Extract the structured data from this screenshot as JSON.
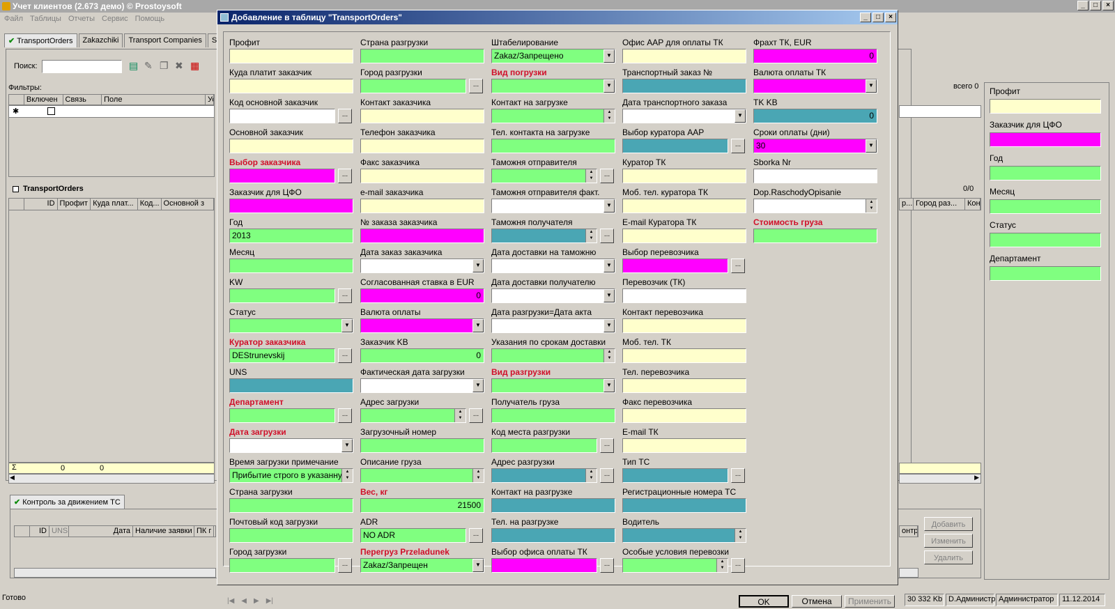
{
  "main": {
    "title": "Учет клиентов (2.673 демо) © Prostoysoft",
    "menu": [
      "Файл",
      "Таблицы",
      "Отчеты",
      "Сервис",
      "Помощь"
    ],
    "tabs": [
      "TransportOrders",
      "Zakazchiki",
      "Transport Companies",
      "S"
    ],
    "search_label": "Поиск:",
    "filters_label": "Фильтры:",
    "filter_cols": [
      "Включен",
      "Связь",
      "Поле",
      "Ус"
    ],
    "grid_title": "TransportOrders",
    "grid_count": "0/0",
    "grid_cols": [
      "ID",
      "Профит",
      "Куда плат...",
      "Код...",
      "Основной з"
    ],
    "grid_cols_right": [
      "р...",
      "Город раз...",
      "Кон"
    ],
    "sum_values": [
      "0",
      "0"
    ],
    "total_label": "всего 0",
    "bottom_tab": "Контроль за движением ТС",
    "bottom_cols": [
      "ID",
      "UNS",
      "Дата",
      "Наличие заявки",
      "ПК г"
    ],
    "bottom_right_col": "онтр",
    "side_buttons": [
      "Добавить",
      "Изменить",
      "Удалить"
    ],
    "right_panel": [
      "Профит",
      "Заказчик для ЦФО",
      "Год",
      "Месяц",
      "Статус",
      "Департамент"
    ],
    "status": {
      "ready": "Готово",
      "mem": "30 332 Kb",
      "user1": "D.Администр",
      "user2": "Администратор",
      "date": "11.12.2014"
    }
  },
  "dialog": {
    "title": "Добавление в таблицу \"TransportOrders\"",
    "ok": "OK",
    "cancel": "Отмена",
    "apply": "Применить",
    "col1": [
      {
        "label": "Профит",
        "value": "",
        "color": "y"
      },
      {
        "label": "Куда платит заказчик",
        "value": "",
        "color": "y"
      },
      {
        "label": "Код основной заказчик",
        "value": "",
        "color": "w",
        "ell": true
      },
      {
        "label": "Основной заказчик",
        "value": "",
        "color": "y"
      },
      {
        "label": "Выбор заказчика",
        "value": "",
        "color": "m",
        "ell": true,
        "red": true
      },
      {
        "label": "Заказчик для ЦФО",
        "value": "",
        "color": "m"
      },
      {
        "label": "Год",
        "value": "2013",
        "color": "g"
      },
      {
        "label": "Месяц",
        "value": "",
        "color": "g"
      },
      {
        "label": "KW",
        "value": "",
        "color": "g",
        "ell": true
      },
      {
        "label": "Статус",
        "value": "",
        "color": "g",
        "dd": true
      },
      {
        "label": "Куратор заказчика",
        "value": "DEStrunevskij",
        "color": "g",
        "ell": true,
        "red": true
      },
      {
        "label": "UNS",
        "value": "",
        "color": "t"
      },
      {
        "label": "Департамент",
        "value": "",
        "color": "g",
        "ell": true,
        "red": true
      },
      {
        "label": "Дата загрузки",
        "value": "",
        "color": "w",
        "dd": true,
        "red": true
      },
      {
        "label": "Время загрузки примечание",
        "value": "Прибытие строго в указанную",
        "color": "g",
        "spin": true
      },
      {
        "label": "Страна загрузки",
        "value": "",
        "color": "g"
      },
      {
        "label": "Почтовый код загрузки",
        "value": "",
        "color": "g"
      },
      {
        "label": "Город загрузки",
        "value": "",
        "color": "g",
        "ell": true
      }
    ],
    "col2": [
      {
        "label": "Страна разгрузки",
        "value": "",
        "color": "g"
      },
      {
        "label": "Город разгрузки",
        "value": "",
        "color": "g",
        "ell": true
      },
      {
        "label": "Контакт заказчика",
        "value": "",
        "color": "y"
      },
      {
        "label": "Телефон заказчика",
        "value": "",
        "color": "y"
      },
      {
        "label": "Факс заказчика",
        "value": "",
        "color": "y"
      },
      {
        "label": "e-mail заказчика",
        "value": "",
        "color": "y"
      },
      {
        "label": "№ заказа заказчика",
        "value": "",
        "color": "m"
      },
      {
        "label": "Дата заказ заказчика",
        "value": "",
        "color": "w",
        "dd": true
      },
      {
        "label": "Согласованная ставка в EUR",
        "value": "0",
        "color": "m",
        "num": true
      },
      {
        "label": "Валюта оплаты",
        "value": "",
        "color": "m",
        "dd": true
      },
      {
        "label": "Заказчик KB",
        "value": "0",
        "color": "g",
        "num": true
      },
      {
        "label": "Фактическая дата загрузки",
        "value": "",
        "color": "w",
        "dd": true
      },
      {
        "label": "Адрес загрузки",
        "value": "",
        "color": "g",
        "spin": true,
        "ell": true
      },
      {
        "label": "Загрузочный номер",
        "value": "",
        "color": "g"
      },
      {
        "label": "Описание груза",
        "value": "",
        "color": "g",
        "spin": true
      },
      {
        "label": "Вес, кг",
        "value": "21500",
        "color": "g",
        "num": true,
        "red": true
      },
      {
        "label": "ADR",
        "value": "NO ADR",
        "color": "g",
        "ell": true
      },
      {
        "label": "Перегруз Przeladunek",
        "value": "Zakaz/Запрещен",
        "color": "g",
        "dd": true,
        "red": true
      }
    ],
    "col3": [
      {
        "label": "Штабелирование",
        "value": "Zakaz/Запрещено",
        "color": "g",
        "dd": true
      },
      {
        "label": "Вид погрузки",
        "value": "",
        "color": "g",
        "dd": true,
        "red": true
      },
      {
        "label": "Контакт на загрузке",
        "value": "",
        "color": "g",
        "spin": true
      },
      {
        "label": "Тел. контакта на загрузке",
        "value": "",
        "color": "g"
      },
      {
        "label": "Таможня отправителя",
        "value": "",
        "color": "g",
        "spin": true,
        "ell": true
      },
      {
        "label": "Таможня отправителя факт.",
        "value": "",
        "color": "w",
        "dd": true
      },
      {
        "label": "Таможня получателя",
        "value": "",
        "color": "t",
        "spin": true,
        "ell": true
      },
      {
        "label": "Дата доставки на таможню",
        "value": "",
        "color": "w",
        "dd": true
      },
      {
        "label": "Дата доставки получателю",
        "value": "",
        "color": "w",
        "dd": true
      },
      {
        "label": "Дата разгрузки=Дата акта",
        "value": "",
        "color": "w",
        "dd": true
      },
      {
        "label": "Указания по срокам доставки",
        "value": "",
        "color": "g",
        "spin": true
      },
      {
        "label": "Вид разгрузки",
        "value": "",
        "color": "g",
        "dd": true,
        "red": true
      },
      {
        "label": "Получатель груза",
        "value": "",
        "color": "g"
      },
      {
        "label": "Код места разгрузки",
        "value": "",
        "color": "g",
        "ell": true
      },
      {
        "label": "Адрес разгрузки",
        "value": "",
        "color": "t",
        "spin": true,
        "ell": true
      },
      {
        "label": "Контакт на разгрузке",
        "value": "",
        "color": "t"
      },
      {
        "label": "Тел. на разгрузке",
        "value": "",
        "color": "t"
      },
      {
        "label": "Выбор офиса оплаты ТК",
        "value": "",
        "color": "m",
        "ell": true
      }
    ],
    "col4": [
      {
        "label": "Офис AAP для оплаты ТК",
        "value": "",
        "color": "y"
      },
      {
        "label": "Транспортный заказ №",
        "value": "",
        "color": "t"
      },
      {
        "label": "Дата транспортного заказа",
        "value": "",
        "color": "w",
        "dd": true
      },
      {
        "label": "Выбор куратора AAP",
        "value": "",
        "color": "t",
        "ell": true
      },
      {
        "label": "Куратор ТК",
        "value": "",
        "color": "y"
      },
      {
        "label": "Моб. тел. куратора ТК",
        "value": "",
        "color": "y"
      },
      {
        "label": "E-mail Куратора ТК",
        "value": "",
        "color": "y"
      },
      {
        "label": "Выбор перевозчика",
        "value": "",
        "color": "m",
        "ell": true
      },
      {
        "label": "Перевозчик  (ТК)",
        "value": "",
        "color": "w"
      },
      {
        "label": "Контакт перевозчика",
        "value": "",
        "color": "y"
      },
      {
        "label": "Моб. тел. ТК",
        "value": "",
        "color": "y"
      },
      {
        "label": "Тел. перевозчика",
        "value": "",
        "color": "y"
      },
      {
        "label": "Факс перевозчика",
        "value": "",
        "color": "y"
      },
      {
        "label": "E-mail ТК",
        "value": "",
        "color": "y"
      },
      {
        "label": "Тип ТС",
        "value": "",
        "color": "t",
        "ell": true
      },
      {
        "label": "Регистрационные номера ТС",
        "value": "",
        "color": "t"
      },
      {
        "label": "Водитель",
        "value": "",
        "color": "t",
        "spin": true
      },
      {
        "label": "Особые условия перевозки",
        "value": "",
        "color": "g",
        "spin": true,
        "ell": true
      }
    ],
    "col5": [
      {
        "label": "Фрахт ТК, EUR",
        "value": "0",
        "color": "m",
        "num": true
      },
      {
        "label": "Валюта оплаты ТК",
        "value": "",
        "color": "m",
        "dd": true
      },
      {
        "label": "TK KB",
        "value": "0",
        "color": "t",
        "num": true
      },
      {
        "label": "Сроки оплаты (дни)",
        "value": "30",
        "color": "m",
        "dd": true
      },
      {
        "label": "Sborka Nr",
        "value": "",
        "color": "w"
      },
      {
        "label": "Dop.RaschodyOpisanie",
        "value": "",
        "color": "w",
        "spin": true
      },
      {
        "label": "Стоимость груза",
        "value": "",
        "color": "g",
        "red": true
      }
    ]
  }
}
